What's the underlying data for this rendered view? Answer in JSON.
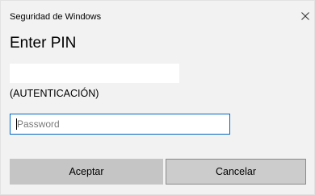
{
  "window": {
    "title": "Seguridad de Windows",
    "close_icon": "close-icon"
  },
  "prompt": {
    "heading": "Enter PIN",
    "subtitle": "(AUTENTICACIÓN)"
  },
  "password_field": {
    "placeholder": "Password",
    "value": ""
  },
  "buttons": {
    "ok_label": "Aceptar",
    "cancel_label": "Cancelar"
  },
  "colors": {
    "dialog_background": "#f2f2f2",
    "input_border_focus": "#0067c0",
    "button_background": "#cccccc"
  }
}
